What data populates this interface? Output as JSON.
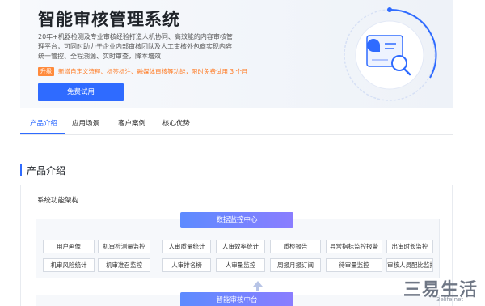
{
  "hero": {
    "title": "智能审核管理系统",
    "desc_line1": "20年+机器检测及专业审核经验打造人机协同、高效能的内容审核管",
    "desc_line2": "理平台，可同时助力于企业内部审核团队及人工审核外包商实现内容",
    "desc_line3": "统一管控、全程溯源、实时审查，降本增效",
    "promo_tag": "升级",
    "promo_text": "新增自定义流程、标签标注、融媒体审核等功能，限时免费试用 3 个月",
    "cta_label": "免费试用"
  },
  "tabs": [
    "产品介绍",
    "应用场景",
    "客户案例",
    "核心优势"
  ],
  "section": {
    "title": "产品介绍",
    "card_label": "系统功能架构"
  },
  "architecture": {
    "top_center": "数据监控中心",
    "row1": [
      "用户画像",
      "机审检测量监控",
      "人审质量统计",
      "人审效率统计",
      "质检报告",
      "异常指标监控报警",
      "出审时长监控"
    ],
    "row2": [
      "机审风险统计",
      "机审准召监控",
      "人审排名榜",
      "人审量监控",
      "周报月报订阅",
      "待审量监控",
      "审核人员配比监控"
    ],
    "bottom_center": "智能审核中台"
  },
  "watermark": {
    "main": "三易生活",
    "sub": "3elife.net"
  },
  "colors": {
    "accent": "#2f6bff",
    "promo": "#ff7a22"
  }
}
